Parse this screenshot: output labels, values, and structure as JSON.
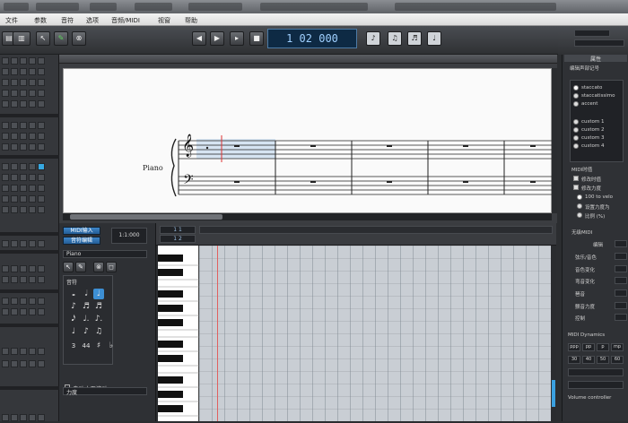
{
  "titlebar": {
    "blobs": [
      "",
      "",
      "",
      "",
      "",
      "",
      ""
    ]
  },
  "menubar": {
    "items": [
      "文件",
      "参数",
      "音符",
      "选项",
      "音频/MIDI",
      "视窗",
      "帮助"
    ]
  },
  "transport": {
    "counter": "1 02 000",
    "counter_sub": "",
    "buttons": [
      "◀",
      "▶",
      "▸",
      "■"
    ]
  },
  "score": {
    "instrument_label": "Piano",
    "treble_clef": "𝄞",
    "bass_clef": "𝄢"
  },
  "piano_panel": {
    "button1": "MIDI输入",
    "button2": "音符编辑",
    "time_display": "1:1:000",
    "instrument_select": "Piano",
    "section_label": "音符",
    "note_glyphs": [
      "𝅝",
      "𝅗𝅥",
      "♩",
      "♪",
      "♬",
      "♬",
      "𝅘𝅥𝅯",
      "♩.",
      "♪.",
      "♩",
      "♪",
      "♫",
      "3",
      "♯",
      "♭",
      "♮"
    ],
    "value_label": "44",
    "checkbox_label": "自动水平滚动",
    "bottom_select": "力度"
  },
  "roll": {
    "ruler_top": "1 1",
    "ruler_bottom": "1 2"
  },
  "right_panel": {
    "header": "属性",
    "title": "编辑声部记号",
    "radios": [
      "staccato",
      "staccatissimo",
      "accent",
      "custom 1",
      "custom 2",
      "custom 3",
      "custom 4"
    ],
    "section2": "MIDI时值",
    "chk1": "修改时值",
    "chk2": "修改力度",
    "opt1": "100 to velo",
    "opt2": "设置力度为",
    "opt3": "比例 (%)",
    "section3": "无级MIDI",
    "rows": [
      "编辑",
      "弦乐/音色",
      "音色变化",
      "弯音变化",
      "琶音",
      "颤音力度",
      "控制"
    ],
    "dyn_header": "MIDI Dynamics",
    "dyn_values": [
      "ppp",
      "pp",
      "p",
      "mp",
      "30",
      "40",
      "50",
      "60"
    ],
    "vol_label": "Volume controller"
  }
}
